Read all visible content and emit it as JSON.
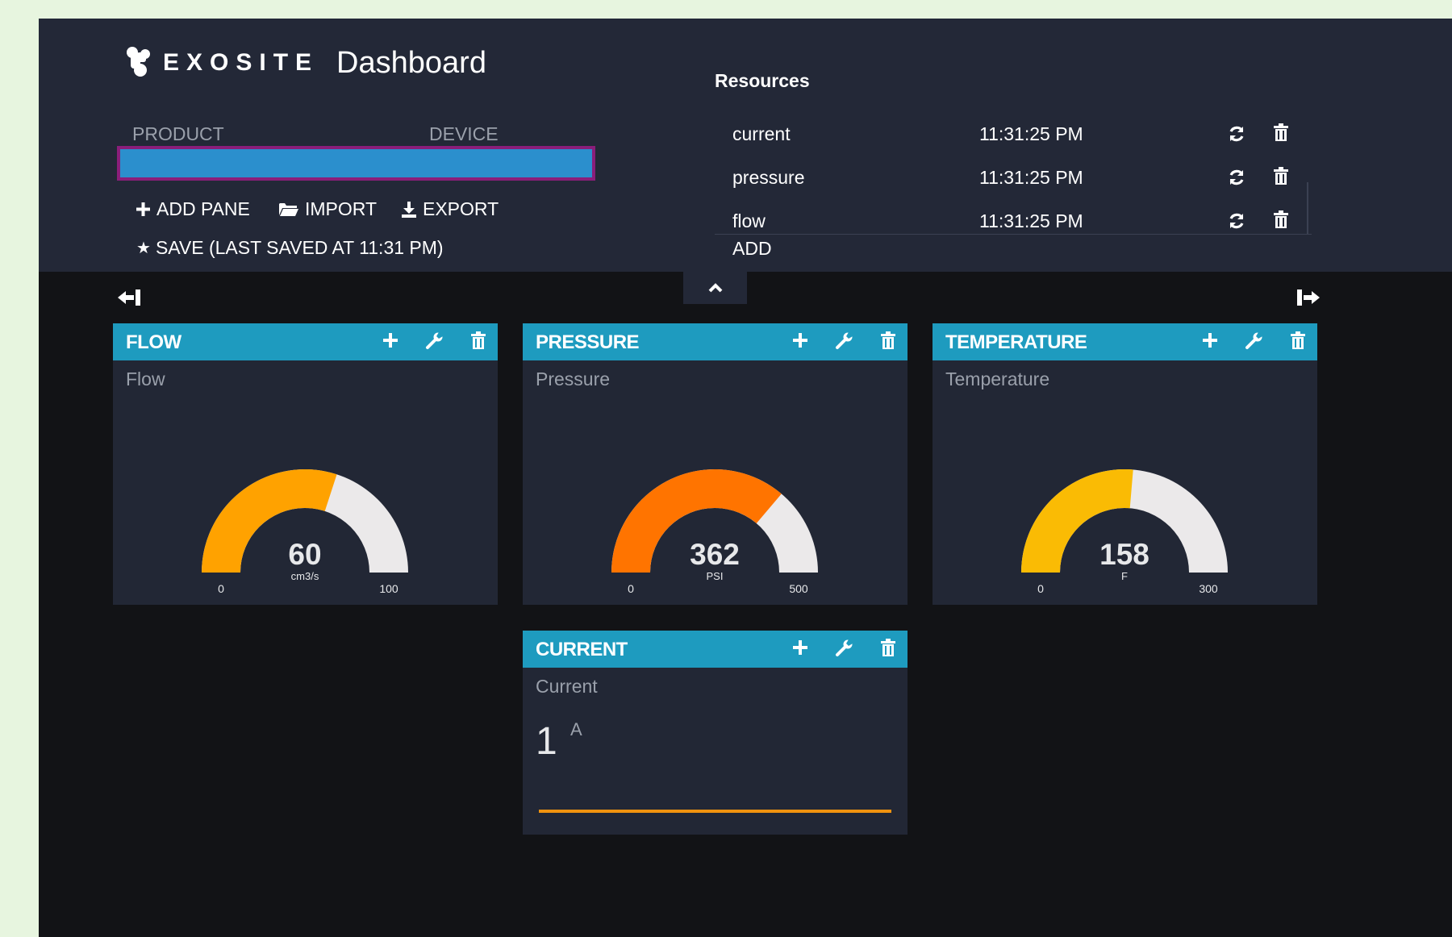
{
  "header": {
    "logo_text": "EXOSITE",
    "title": "Dashboard",
    "product_label": "PRODUCT",
    "device_label": "DEVICE",
    "toolbar": {
      "add_pane": "ADD PANE",
      "import": "IMPORT",
      "export": "EXPORT",
      "save": "SAVE (LAST SAVED AT 11:31 PM)"
    }
  },
  "resources": {
    "title": "Resources",
    "items": [
      {
        "name": "current",
        "time": "11:31:25 PM"
      },
      {
        "name": "pressure",
        "time": "11:31:25 PM"
      },
      {
        "name": "flow",
        "time": "11:31:25 PM"
      }
    ],
    "add_label": "ADD"
  },
  "panes": [
    {
      "title": "FLOW",
      "widget_title": "Flow",
      "widget": "gauge",
      "value": 60,
      "min": 0,
      "max": 100,
      "units": "cm3/s",
      "color": "#ffa200"
    },
    {
      "title": "PRESSURE",
      "widget_title": "Pressure",
      "widget": "gauge",
      "value": 362,
      "min": 0,
      "max": 500,
      "units": "PSI",
      "color": "#ff7400"
    },
    {
      "title": "TEMPERATURE",
      "widget_title": "Temperature",
      "widget": "gauge",
      "value": 158,
      "min": 0,
      "max": 300,
      "units": "F",
      "color": "#fabb04"
    },
    {
      "title": "CURRENT",
      "widget_title": "Current",
      "widget": "text",
      "value": "1",
      "units": "A",
      "sparkline_color": "#f0930f"
    }
  ],
  "colors": {
    "page_bg": "#121316",
    "header_bg": "#232837",
    "pane_header": "#1e9bbf",
    "pane_bg": "#222735",
    "selector_fill": "#2b8fcd",
    "selector_border": "#8a1e7a",
    "gauge_track": "#ebe9ea"
  },
  "icons": {
    "logo": "exosite-logo-icon",
    "add": "plus-icon",
    "import": "folder-open-icon",
    "export": "download-icon",
    "save": "star-icon",
    "refresh": "refresh-icon",
    "delete": "trash-icon",
    "settings": "wrench-icon",
    "collapse": "chevron-up-icon",
    "shrink": "arrow-left-bar-icon",
    "expand": "arrow-right-bar-icon"
  }
}
